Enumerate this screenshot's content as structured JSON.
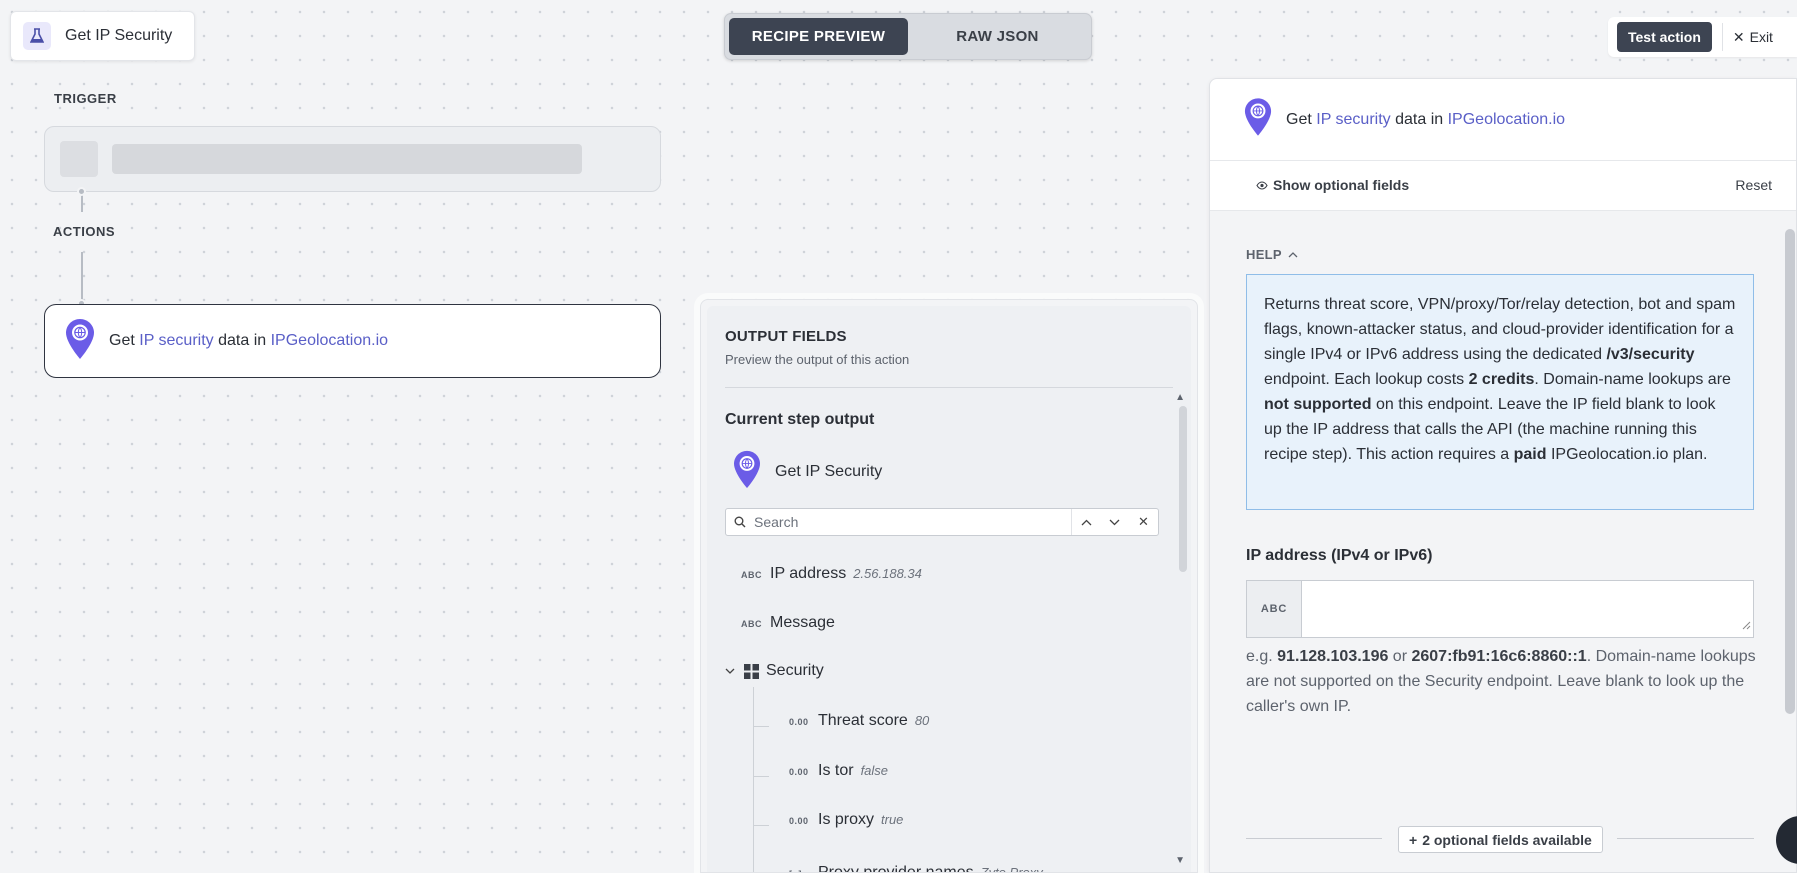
{
  "app": {
    "title": "Get IP Security",
    "tabs": [
      {
        "label": "RECIPE PREVIEW",
        "active": true
      },
      {
        "label": "RAW JSON",
        "active": false
      }
    ],
    "test_action_label": "Test action",
    "exit_label": "Exit"
  },
  "canvas": {
    "trigger_label": "TRIGGER",
    "actions_label": "ACTIONS",
    "action": {
      "prefix": "Get",
      "object": "IP security",
      "middle": "data in",
      "app": "IPGeolocation.io"
    }
  },
  "output": {
    "title": "OUTPUT FIELDS",
    "subtitle": "Preview the output of this action",
    "current_step_label": "Current step output",
    "step_name": "Get IP Security",
    "search_placeholder": "Search",
    "fields": [
      {
        "type": "ABC",
        "name": "IP address",
        "value": "2.56.188.34"
      },
      {
        "type": "ABC",
        "name": "Message",
        "value": ""
      }
    ],
    "group": {
      "name": "Security",
      "children": [
        {
          "type": "0.00",
          "name": "Threat score",
          "value": "80"
        },
        {
          "type": "0.00",
          "name": "Is tor",
          "value": "false"
        },
        {
          "type": "0.00",
          "name": "Is proxy",
          "value": "true"
        },
        {
          "type": "[..]",
          "name": "Proxy provider names",
          "value": "Zyte Proxy"
        }
      ]
    }
  },
  "config": {
    "header": {
      "prefix": "Get",
      "object": "IP security",
      "middle": "data in",
      "app": "IPGeolocation.io"
    },
    "show_optional_label": "Show optional fields",
    "reset_label": "Reset",
    "help_label": "HELP",
    "help": {
      "t1": "Returns threat score, VPN/proxy/Tor/relay detection, bot and spam flags, known-attacker status, and cloud-provider identification for a single IPv4 or IPv6 address using the dedicated ",
      "b1": "/v3/security",
      "t2": " endpoint. Each lookup costs ",
      "b2": "2 credits",
      "t3": ". Domain-name lookups are ",
      "b3": "not supported",
      "t4": " on this endpoint. Leave the IP field blank to look up the IP address that calls the API (the machine running this recipe step). This action requires a ",
      "b4": "paid",
      "t5": " IPGeolocation.io plan."
    },
    "ip_field": {
      "label": "IP address (IPv4 or IPv6)",
      "type": "ABC",
      "value": "",
      "hint_prefix": "e.g. ",
      "hint_ex1": "91.128.103.196",
      "hint_or": " or ",
      "hint_ex2": "2607:fb91:16c6:8860::1",
      "hint_rest": ". Domain-name lookups are not supported on the Security endpoint. Leave blank to look up the caller's own IP."
    },
    "optional_fields_label": "2 optional fields available"
  },
  "colors": {
    "accent": "#5a5fc7",
    "dark_button": "#3d4452",
    "pin": "#6b5ce7",
    "help_bg": "#e8f2fb",
    "help_border": "#8fbde8"
  },
  "icons": [
    "flask-icon",
    "map-pin-icon",
    "search-icon",
    "chevron-up-icon",
    "chevron-down-icon",
    "close-icon",
    "eye-icon",
    "grid-icon",
    "plus-icon"
  ]
}
